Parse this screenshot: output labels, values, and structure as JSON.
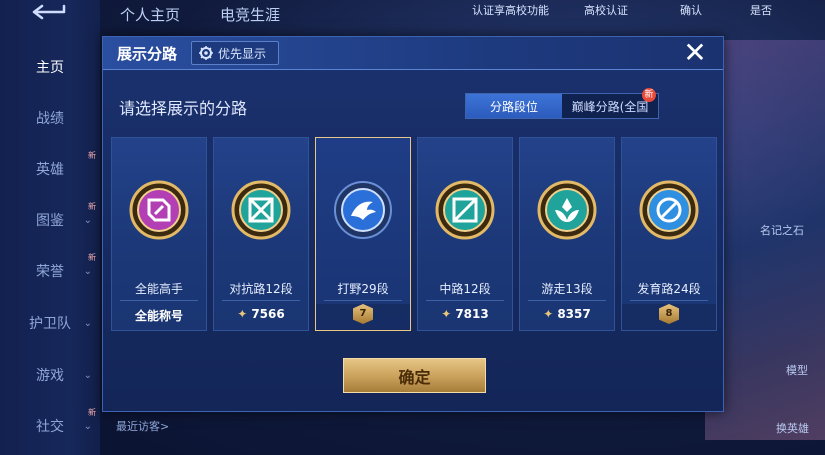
{
  "colors": {
    "accent": "#2c5cbc",
    "gold": "#e8c889",
    "text": "#e6eeff"
  },
  "sidebar": {
    "back_icon": "back-arrow-icon",
    "items": [
      {
        "label": "主页",
        "active": true
      },
      {
        "label": "战绩"
      },
      {
        "label": "英雄",
        "new": "新"
      },
      {
        "label": "图鉴",
        "new": "新",
        "arrow": "⌄"
      },
      {
        "label": "荣誉",
        "new": "新",
        "arrow": "⌄"
      },
      {
        "label": "护卫队",
        "arrow": "⌄"
      },
      {
        "label": "游戏",
        "arrow": "⌄"
      },
      {
        "label": "社交",
        "new": "新",
        "arrow": "⌄"
      }
    ]
  },
  "top": {
    "tabs": [
      "个人主页",
      "电竞生涯"
    ],
    "right_text": "认证享高校功能",
    "school_label": "高校认证",
    "right_words": [
      "确认",
      "是否"
    ],
    "right_labels": [
      "模型",
      "换英雄"
    ],
    "right_note": "名记之石"
  },
  "dialog": {
    "title": "展示分路",
    "priority_label": "优先显示",
    "close_icon": "close-icon",
    "subtitle": "请选择展示的分路",
    "toggle": {
      "left": "分路段位",
      "right": "巅峰分路(全国",
      "right_badge": "新"
    },
    "cards": [
      {
        "label": "全能高手",
        "value": "全能称号",
        "emblem": "allround",
        "star": false
      },
      {
        "label": "对抗路12段",
        "value": "7566",
        "emblem": "clash",
        "star": true
      },
      {
        "label": "打野29段",
        "value": "",
        "badge": "7",
        "emblem": "jungle",
        "selected": true
      },
      {
        "label": "中路12段",
        "value": "7813",
        "emblem": "mid",
        "star": true
      },
      {
        "label": "游走13段",
        "value": "8357",
        "emblem": "roam",
        "star": true
      },
      {
        "label": "发育路24段",
        "value": "",
        "badge": "8",
        "emblem": "farm"
      }
    ],
    "confirm_label": "确定"
  },
  "visitors_label": "最近访客>"
}
